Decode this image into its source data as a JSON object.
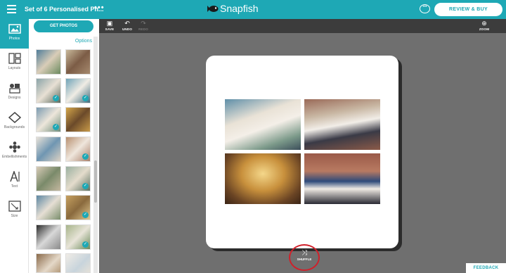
{
  "header": {
    "project_title": "Set of 6 Personalised Ph...",
    "more": "•••",
    "brand": "Snapfish",
    "review_button": "REVIEW & BUY",
    "brand_color": "#1ea8b5"
  },
  "rail": {
    "items": [
      {
        "label": "Photos",
        "icon": "photos-icon",
        "active": true
      },
      {
        "label": "Layouts",
        "icon": "layouts-icon"
      },
      {
        "label": "Designs",
        "icon": "designs-icon"
      },
      {
        "label": "Backgrounds",
        "icon": "backgrounds-icon"
      },
      {
        "label": "Embellishments",
        "icon": "embellishments-icon"
      },
      {
        "label": "Text",
        "icon": "text-icon"
      },
      {
        "label": "Size",
        "icon": "size-icon"
      }
    ]
  },
  "panel": {
    "get_photos": "GET PHOTOS",
    "options": "Options"
  },
  "toolbar": {
    "save": "SAVE",
    "undo": "UNDO",
    "redo": "REDO",
    "zoom": "ZOOM"
  },
  "canvas": {
    "shuffle": "SHUFFLE",
    "highlight_color": "#d0202a"
  },
  "footer": {
    "feedback": "FEEDBACK"
  }
}
